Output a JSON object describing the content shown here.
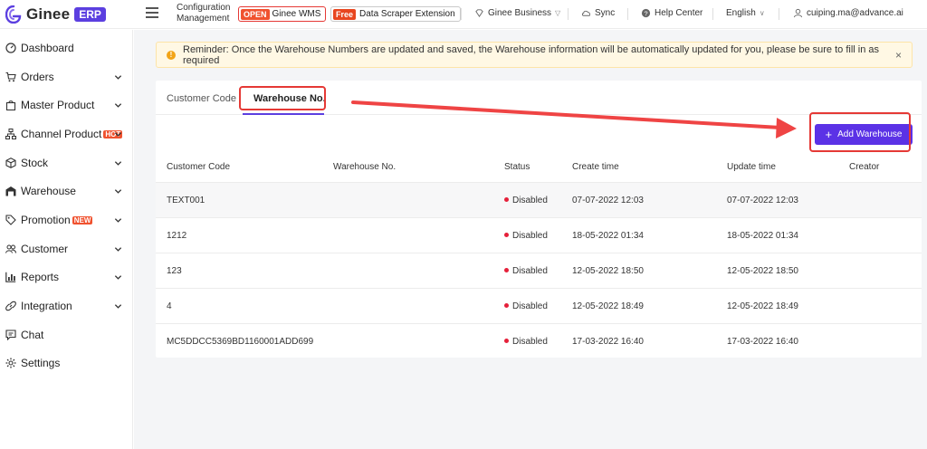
{
  "app": {
    "name": "Ginee",
    "badge": "ERP"
  },
  "header": {
    "config_label_1": "Configuration",
    "config_label_2": "Management",
    "wms_pill": "OPEN",
    "wms_label": "Ginee WMS",
    "scraper_pill": "Free",
    "scraper_label": "Data Scraper Extension",
    "business_label": "Ginee Business",
    "sync_label": "Sync",
    "help_label": "Help Center",
    "language_label": "English",
    "user_email": "cuiping.ma@advance.ai"
  },
  "sidebar": {
    "items": [
      {
        "label": "Dashboard",
        "icon": "dashboard-icon"
      },
      {
        "label": "Orders",
        "icon": "cart-icon"
      },
      {
        "label": "Master Product",
        "icon": "bag-icon"
      },
      {
        "label": "Channel Product",
        "icon": "network-icon",
        "badge": "HOT"
      },
      {
        "label": "Stock",
        "icon": "box-icon"
      },
      {
        "label": "Warehouse",
        "icon": "warehouse-icon"
      },
      {
        "label": "Promotion",
        "icon": "tag-icon",
        "badge": "NEW"
      },
      {
        "label": "Customer",
        "icon": "users-icon"
      },
      {
        "label": "Reports",
        "icon": "chart-icon"
      },
      {
        "label": "Integration",
        "icon": "link-icon"
      },
      {
        "label": "Chat",
        "icon": "chat-icon"
      },
      {
        "label": "Settings",
        "icon": "gear-icon"
      }
    ]
  },
  "reminder": {
    "text": "Reminder: Once the Warehouse Numbers are updated and saved, the Warehouse information will be automatically updated for you, please be sure to fill in as required",
    "close": "×"
  },
  "tabs": [
    {
      "label": "Customer Code"
    },
    {
      "label": "Warehouse No."
    }
  ],
  "actions": {
    "add_warehouse": "Add Warehouse",
    "plus": "+"
  },
  "table": {
    "columns": [
      "Customer Code",
      "Warehouse No.",
      "Status",
      "Create time",
      "Update time",
      "Creator"
    ],
    "rows": [
      {
        "customer_code": "TEXT001",
        "warehouse_no": "",
        "status": "Disabled",
        "create_time": "07-07-2022 12:03",
        "update_time": "07-07-2022 12:03",
        "creator": ""
      },
      {
        "customer_code": "1212",
        "warehouse_no": "",
        "status": "Disabled",
        "create_time": "18-05-2022 01:34",
        "update_time": "18-05-2022 01:34",
        "creator": ""
      },
      {
        "customer_code": "123",
        "warehouse_no": "",
        "status": "Disabled",
        "create_time": "12-05-2022 18:50",
        "update_time": "12-05-2022 18:50",
        "creator": ""
      },
      {
        "customer_code": "4",
        "warehouse_no": "",
        "status": "Disabled",
        "create_time": "12-05-2022 18:49",
        "update_time": "12-05-2022 18:49",
        "creator": ""
      },
      {
        "customer_code": "MC5DDCC5369BD1160001ADD699",
        "warehouse_no": "",
        "status": "Disabled",
        "create_time": "17-03-2022 16:40",
        "update_time": "17-03-2022 16:40",
        "creator": ""
      }
    ]
  },
  "colors": {
    "brand": "#5b3fe0",
    "accent_button": "#5b32e6",
    "highlight": "#e53935",
    "status_disabled": "#e5203a",
    "warning": "#f2a417"
  }
}
